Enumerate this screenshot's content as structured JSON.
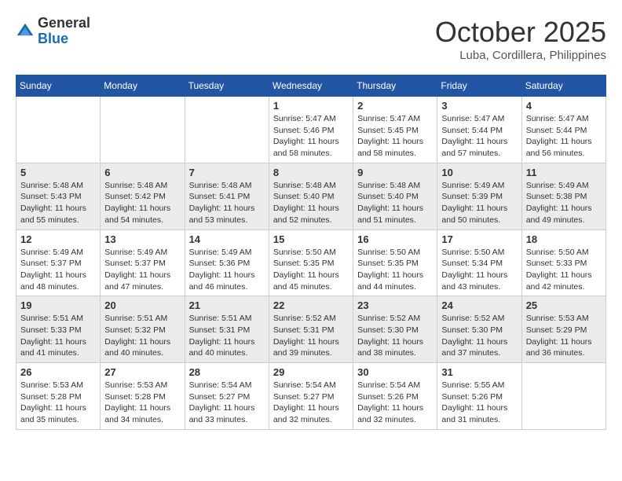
{
  "header": {
    "logo_general": "General",
    "logo_blue": "Blue",
    "month": "October 2025",
    "location": "Luba, Cordillera, Philippines"
  },
  "weekdays": [
    "Sunday",
    "Monday",
    "Tuesday",
    "Wednesday",
    "Thursday",
    "Friday",
    "Saturday"
  ],
  "weeks": [
    [
      {
        "day": "",
        "sunrise": "",
        "sunset": "",
        "daylight": ""
      },
      {
        "day": "",
        "sunrise": "",
        "sunset": "",
        "daylight": ""
      },
      {
        "day": "",
        "sunrise": "",
        "sunset": "",
        "daylight": ""
      },
      {
        "day": "1",
        "sunrise": "Sunrise: 5:47 AM",
        "sunset": "Sunset: 5:46 PM",
        "daylight": "Daylight: 11 hours and 58 minutes."
      },
      {
        "day": "2",
        "sunrise": "Sunrise: 5:47 AM",
        "sunset": "Sunset: 5:45 PM",
        "daylight": "Daylight: 11 hours and 58 minutes."
      },
      {
        "day": "3",
        "sunrise": "Sunrise: 5:47 AM",
        "sunset": "Sunset: 5:44 PM",
        "daylight": "Daylight: 11 hours and 57 minutes."
      },
      {
        "day": "4",
        "sunrise": "Sunrise: 5:47 AM",
        "sunset": "Sunset: 5:44 PM",
        "daylight": "Daylight: 11 hours and 56 minutes."
      }
    ],
    [
      {
        "day": "5",
        "sunrise": "Sunrise: 5:48 AM",
        "sunset": "Sunset: 5:43 PM",
        "daylight": "Daylight: 11 hours and 55 minutes."
      },
      {
        "day": "6",
        "sunrise": "Sunrise: 5:48 AM",
        "sunset": "Sunset: 5:42 PM",
        "daylight": "Daylight: 11 hours and 54 minutes."
      },
      {
        "day": "7",
        "sunrise": "Sunrise: 5:48 AM",
        "sunset": "Sunset: 5:41 PM",
        "daylight": "Daylight: 11 hours and 53 minutes."
      },
      {
        "day": "8",
        "sunrise": "Sunrise: 5:48 AM",
        "sunset": "Sunset: 5:40 PM",
        "daylight": "Daylight: 11 hours and 52 minutes."
      },
      {
        "day": "9",
        "sunrise": "Sunrise: 5:48 AM",
        "sunset": "Sunset: 5:40 PM",
        "daylight": "Daylight: 11 hours and 51 minutes."
      },
      {
        "day": "10",
        "sunrise": "Sunrise: 5:49 AM",
        "sunset": "Sunset: 5:39 PM",
        "daylight": "Daylight: 11 hours and 50 minutes."
      },
      {
        "day": "11",
        "sunrise": "Sunrise: 5:49 AM",
        "sunset": "Sunset: 5:38 PM",
        "daylight": "Daylight: 11 hours and 49 minutes."
      }
    ],
    [
      {
        "day": "12",
        "sunrise": "Sunrise: 5:49 AM",
        "sunset": "Sunset: 5:37 PM",
        "daylight": "Daylight: 11 hours and 48 minutes."
      },
      {
        "day": "13",
        "sunrise": "Sunrise: 5:49 AM",
        "sunset": "Sunset: 5:37 PM",
        "daylight": "Daylight: 11 hours and 47 minutes."
      },
      {
        "day": "14",
        "sunrise": "Sunrise: 5:49 AM",
        "sunset": "Sunset: 5:36 PM",
        "daylight": "Daylight: 11 hours and 46 minutes."
      },
      {
        "day": "15",
        "sunrise": "Sunrise: 5:50 AM",
        "sunset": "Sunset: 5:35 PM",
        "daylight": "Daylight: 11 hours and 45 minutes."
      },
      {
        "day": "16",
        "sunrise": "Sunrise: 5:50 AM",
        "sunset": "Sunset: 5:35 PM",
        "daylight": "Daylight: 11 hours and 44 minutes."
      },
      {
        "day": "17",
        "sunrise": "Sunrise: 5:50 AM",
        "sunset": "Sunset: 5:34 PM",
        "daylight": "Daylight: 11 hours and 43 minutes."
      },
      {
        "day": "18",
        "sunrise": "Sunrise: 5:50 AM",
        "sunset": "Sunset: 5:33 PM",
        "daylight": "Daylight: 11 hours and 42 minutes."
      }
    ],
    [
      {
        "day": "19",
        "sunrise": "Sunrise: 5:51 AM",
        "sunset": "Sunset: 5:33 PM",
        "daylight": "Daylight: 11 hours and 41 minutes."
      },
      {
        "day": "20",
        "sunrise": "Sunrise: 5:51 AM",
        "sunset": "Sunset: 5:32 PM",
        "daylight": "Daylight: 11 hours and 40 minutes."
      },
      {
        "day": "21",
        "sunrise": "Sunrise: 5:51 AM",
        "sunset": "Sunset: 5:31 PM",
        "daylight": "Daylight: 11 hours and 40 minutes."
      },
      {
        "day": "22",
        "sunrise": "Sunrise: 5:52 AM",
        "sunset": "Sunset: 5:31 PM",
        "daylight": "Daylight: 11 hours and 39 minutes."
      },
      {
        "day": "23",
        "sunrise": "Sunrise: 5:52 AM",
        "sunset": "Sunset: 5:30 PM",
        "daylight": "Daylight: 11 hours and 38 minutes."
      },
      {
        "day": "24",
        "sunrise": "Sunrise: 5:52 AM",
        "sunset": "Sunset: 5:30 PM",
        "daylight": "Daylight: 11 hours and 37 minutes."
      },
      {
        "day": "25",
        "sunrise": "Sunrise: 5:53 AM",
        "sunset": "Sunset: 5:29 PM",
        "daylight": "Daylight: 11 hours and 36 minutes."
      }
    ],
    [
      {
        "day": "26",
        "sunrise": "Sunrise: 5:53 AM",
        "sunset": "Sunset: 5:28 PM",
        "daylight": "Daylight: 11 hours and 35 minutes."
      },
      {
        "day": "27",
        "sunrise": "Sunrise: 5:53 AM",
        "sunset": "Sunset: 5:28 PM",
        "daylight": "Daylight: 11 hours and 34 minutes."
      },
      {
        "day": "28",
        "sunrise": "Sunrise: 5:54 AM",
        "sunset": "Sunset: 5:27 PM",
        "daylight": "Daylight: 11 hours and 33 minutes."
      },
      {
        "day": "29",
        "sunrise": "Sunrise: 5:54 AM",
        "sunset": "Sunset: 5:27 PM",
        "daylight": "Daylight: 11 hours and 32 minutes."
      },
      {
        "day": "30",
        "sunrise": "Sunrise: 5:54 AM",
        "sunset": "Sunset: 5:26 PM",
        "daylight": "Daylight: 11 hours and 32 minutes."
      },
      {
        "day": "31",
        "sunrise": "Sunrise: 5:55 AM",
        "sunset": "Sunset: 5:26 PM",
        "daylight": "Daylight: 11 hours and 31 minutes."
      },
      {
        "day": "",
        "sunrise": "",
        "sunset": "",
        "daylight": ""
      }
    ]
  ]
}
